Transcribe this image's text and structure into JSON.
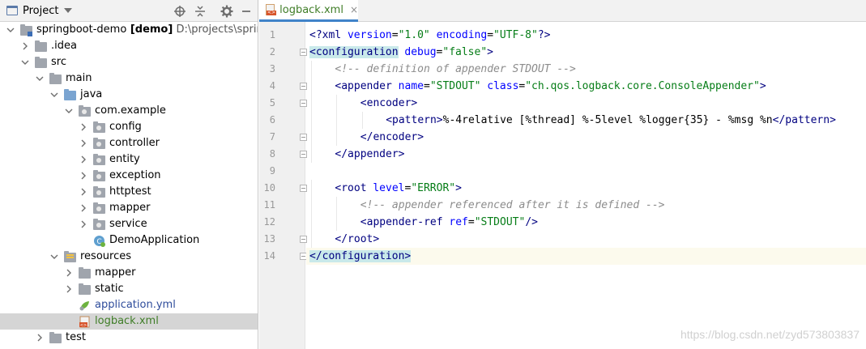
{
  "project_panel": {
    "title": "Project",
    "tree": [
      {
        "label": "springboot-demo",
        "suffix": " [demo]",
        "path": "D:\\projects\\springboo",
        "depth": 0,
        "expanded": true,
        "icon": "module-folder",
        "style": "normal"
      },
      {
        "label": ".idea",
        "depth": 1,
        "expanded": false,
        "icon": "folder",
        "style": "normal"
      },
      {
        "label": "src",
        "depth": 1,
        "expanded": true,
        "icon": "folder",
        "style": "normal"
      },
      {
        "label": "main",
        "depth": 2,
        "expanded": true,
        "icon": "folder",
        "style": "normal"
      },
      {
        "label": "java",
        "depth": 3,
        "expanded": true,
        "icon": "source-folder",
        "style": "normal"
      },
      {
        "label": "com.example",
        "depth": 4,
        "expanded": true,
        "icon": "package",
        "style": "normal"
      },
      {
        "label": "config",
        "depth": 5,
        "expanded": false,
        "icon": "package",
        "style": "normal"
      },
      {
        "label": "controller",
        "depth": 5,
        "expanded": false,
        "icon": "package",
        "style": "normal"
      },
      {
        "label": "entity",
        "depth": 5,
        "expanded": false,
        "icon": "package",
        "style": "normal"
      },
      {
        "label": "exception",
        "depth": 5,
        "expanded": false,
        "icon": "package",
        "style": "normal"
      },
      {
        "label": "httptest",
        "depth": 5,
        "expanded": false,
        "icon": "package",
        "style": "normal"
      },
      {
        "label": "mapper",
        "depth": 5,
        "expanded": false,
        "icon": "package",
        "style": "normal"
      },
      {
        "label": "service",
        "depth": 5,
        "expanded": false,
        "icon": "package",
        "style": "normal"
      },
      {
        "label": "DemoApplication",
        "depth": 5,
        "expanded": null,
        "icon": "spring-class",
        "style": "normal"
      },
      {
        "label": "resources",
        "depth": 3,
        "expanded": true,
        "icon": "resources-folder",
        "style": "normal"
      },
      {
        "label": "mapper",
        "depth": 4,
        "expanded": false,
        "icon": "folder",
        "style": "normal"
      },
      {
        "label": "static",
        "depth": 4,
        "expanded": false,
        "icon": "folder",
        "style": "normal"
      },
      {
        "label": "application.yml",
        "depth": 4,
        "expanded": null,
        "icon": "yml-file",
        "style": "blue"
      },
      {
        "label": "logback.xml",
        "depth": 4,
        "expanded": null,
        "icon": "xml-file",
        "style": "green",
        "selected": true
      },
      {
        "label": "test",
        "depth": 2,
        "expanded": false,
        "icon": "folder",
        "style": "normal"
      }
    ]
  },
  "editor": {
    "tab_label": "logback.xml",
    "tab_close": "×",
    "lines": [
      {
        "n": "1",
        "indent": 0,
        "tokens": [
          [
            "tag",
            "<?xml "
          ],
          [
            "attr",
            "version"
          ],
          [
            "plain",
            "="
          ],
          [
            "val",
            "\"1.0\""
          ],
          [
            "plain",
            " "
          ],
          [
            "attr",
            "encoding"
          ],
          [
            "plain",
            "="
          ],
          [
            "val",
            "\"UTF-8\""
          ],
          [
            "tag",
            "?>"
          ]
        ]
      },
      {
        "n": "2",
        "indent": 0,
        "fold": true,
        "tokens": [
          [
            "hltag",
            "<configuration"
          ],
          [
            "plain",
            " "
          ],
          [
            "attr",
            "debug"
          ],
          [
            "plain",
            "="
          ],
          [
            "val",
            "\"false\""
          ],
          [
            "tag",
            ">"
          ]
        ]
      },
      {
        "n": "3",
        "indent": 1,
        "tokens": [
          [
            "cmt",
            "<!-- definition of appender STDOUT -->"
          ]
        ]
      },
      {
        "n": "4",
        "indent": 1,
        "fold": true,
        "tokens": [
          [
            "tag",
            "<appender "
          ],
          [
            "attr",
            "name"
          ],
          [
            "plain",
            "="
          ],
          [
            "val",
            "\"STDOUT\""
          ],
          [
            "plain",
            " "
          ],
          [
            "attr",
            "class"
          ],
          [
            "plain",
            "="
          ],
          [
            "val",
            "\"ch.qos.logback.core.ConsoleAppender\""
          ],
          [
            "tag",
            ">"
          ]
        ]
      },
      {
        "n": "5",
        "indent": 2,
        "fold": true,
        "tokens": [
          [
            "tag",
            "<encoder>"
          ]
        ]
      },
      {
        "n": "6",
        "indent": 3,
        "tokens": [
          [
            "tag",
            "<pattern>"
          ],
          [
            "plain",
            "%-4relative [%thread] %-5level %logger{35} - %msg %n"
          ],
          [
            "tag",
            "</pattern>"
          ]
        ]
      },
      {
        "n": "7",
        "indent": 2,
        "fold": true,
        "tokens": [
          [
            "tag",
            "</encoder>"
          ]
        ]
      },
      {
        "n": "8",
        "indent": 1,
        "fold": true,
        "tokens": [
          [
            "tag",
            "</appender>"
          ]
        ]
      },
      {
        "n": "9",
        "indent": 0,
        "tokens": []
      },
      {
        "n": "10",
        "indent": 1,
        "fold": true,
        "tokens": [
          [
            "tag",
            "<root "
          ],
          [
            "attr",
            "level"
          ],
          [
            "plain",
            "="
          ],
          [
            "val",
            "\"ERROR\""
          ],
          [
            "tag",
            ">"
          ]
        ]
      },
      {
        "n": "11",
        "indent": 2,
        "tokens": [
          [
            "cmt",
            "<!-- appender referenced after it is defined -->"
          ]
        ]
      },
      {
        "n": "12",
        "indent": 2,
        "tokens": [
          [
            "tag",
            "<appender-ref "
          ],
          [
            "attr",
            "ref"
          ],
          [
            "plain",
            "="
          ],
          [
            "val",
            "\"STDOUT\""
          ],
          [
            "tag",
            "/>"
          ]
        ]
      },
      {
        "n": "13",
        "indent": 1,
        "fold": true,
        "tokens": [
          [
            "tag",
            "</root>"
          ]
        ]
      },
      {
        "n": "14",
        "indent": 0,
        "fold": true,
        "current": true,
        "tokens": [
          [
            "hltag",
            "</configuration"
          ],
          [
            "hltag",
            ">"
          ]
        ]
      }
    ]
  },
  "watermark": "https://blog.csdn.net/zyd573803837",
  "colors": {
    "tag": "#000080",
    "attr": "#0000ff",
    "value": "#067d17",
    "comment": "#8c8c8c",
    "selection": "#d5d5d5",
    "tab_underline": "#4083c9"
  }
}
